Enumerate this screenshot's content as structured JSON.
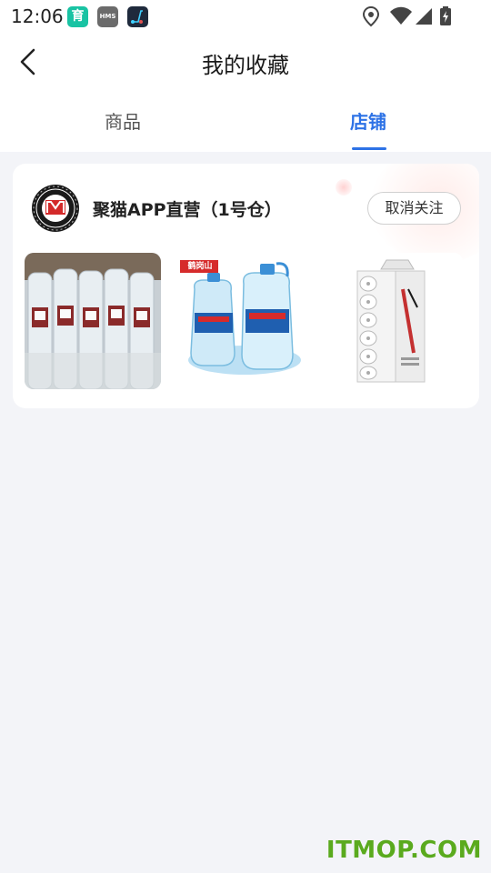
{
  "status_bar": {
    "time": "12:06",
    "app_icons": [
      "育",
      "HMS",
      "scooter"
    ]
  },
  "header": {
    "title": "我的收藏"
  },
  "tabs": [
    {
      "label": "商品",
      "active": false
    },
    {
      "label": "店铺",
      "active": true
    }
  ],
  "shop": {
    "name": "聚猫APP直营（1号仓）",
    "unfollow_label": "取消关注",
    "products": [
      {
        "image": "bottled water pack"
      },
      {
        "image": "large water jugs",
        "brand_text": "鹤岗山"
      },
      {
        "image": "toilet paper rolls pack"
      }
    ]
  },
  "watermark": "ITMOP.COM",
  "colors": {
    "accent": "#2d72e6",
    "background": "#f3f4f8",
    "watermark": "#5aaa1e"
  }
}
